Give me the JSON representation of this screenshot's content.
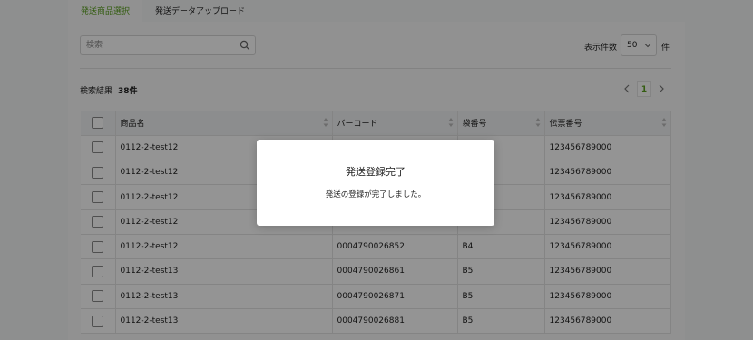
{
  "tabs": [
    {
      "label": "発送商品選択",
      "active": true
    },
    {
      "label": "発送データアップロード",
      "active": false
    }
  ],
  "search": {
    "placeholder": "検索",
    "value": ""
  },
  "per_page": {
    "label": "表示件数",
    "value": "50",
    "unit": "件"
  },
  "results": {
    "label": "検索結果",
    "count": "38件"
  },
  "pagination": {
    "current": "1"
  },
  "table": {
    "headers": [
      "商品名",
      "バーコード",
      "袋番号",
      "伝票番号"
    ],
    "rows": [
      {
        "name": "0112-2-test12",
        "barcode": "",
        "bag": "",
        "slip": "123456789000"
      },
      {
        "name": "0112-2-test12",
        "barcode": "",
        "bag": "",
        "slip": "123456789000"
      },
      {
        "name": "0112-2-test12",
        "barcode": "",
        "bag": "",
        "slip": "123456789000"
      },
      {
        "name": "0112-2-test12",
        "barcode": "",
        "bag": "",
        "slip": "123456789000"
      },
      {
        "name": "0112-2-test12",
        "barcode": "0004790026852",
        "bag": "B4",
        "slip": "123456789000"
      },
      {
        "name": "0112-2-test13",
        "barcode": "0004790026861",
        "bag": "B5",
        "slip": "123456789000"
      },
      {
        "name": "0112-2-test13",
        "barcode": "0004790026871",
        "bag": "B5",
        "slip": "123456789000"
      },
      {
        "name": "0112-2-test13",
        "barcode": "0004790026881",
        "bag": "B5",
        "slip": "123456789000"
      }
    ]
  },
  "modal": {
    "title": "発送登録完了",
    "message": "発送の登録が完了しました。"
  },
  "colors": {
    "accent": "#5aa01e",
    "overlay": "rgba(0,0,0,0.42)"
  }
}
